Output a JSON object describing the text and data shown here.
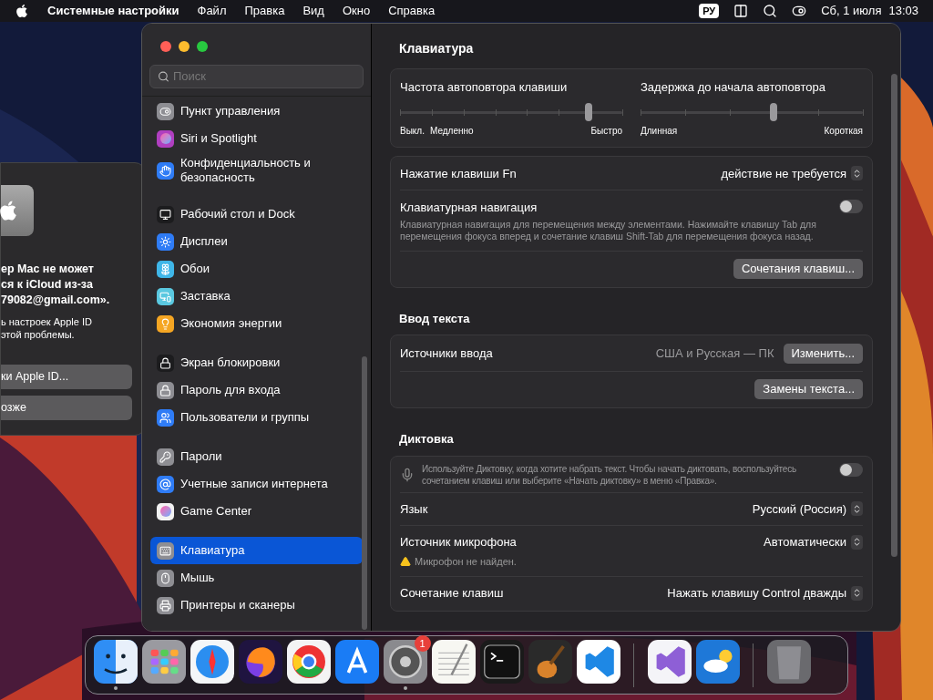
{
  "menu_bar": {
    "app": "Системные настройки",
    "menus": [
      "Файл",
      "Правка",
      "Вид",
      "Окно",
      "Справка"
    ],
    "input_source": "РУ",
    "date": "Сб, 1 июля",
    "time": "13:03"
  },
  "dialog": {
    "title_lines": [
      "ер Mac не может",
      "ся к iCloud из-за",
      "79082@gmail.com»."
    ],
    "body_lines": [
      "ь настроек Apple ID",
      "этой проблемы."
    ],
    "buttons": [
      "ки Apple ID...",
      "озже"
    ]
  },
  "sidebar": {
    "search": {
      "placeholder": "Поиск"
    },
    "groups": [
      [
        {
          "label": "Пункт управления",
          "color": "#8e8e93",
          "selected": false
        },
        {
          "label": "Siri и Spotlight",
          "color": "#b03fc0",
          "selected": false
        },
        {
          "label": "Конфиденциальность и безопасность",
          "color": "#2f7cf6",
          "selected": false
        }
      ],
      [
        {
          "label": "Рабочий стол и Dock",
          "color": "#1c1c1e",
          "selected": false
        },
        {
          "label": "Дисплеи",
          "color": "#2f7cf6",
          "selected": false
        },
        {
          "label": "Обои",
          "color": "#3fb6e8",
          "selected": false
        },
        {
          "label": "Заставка",
          "color": "#5ac8e0",
          "selected": false
        },
        {
          "label": "Экономия энергии",
          "color": "#f5a623",
          "selected": false
        }
      ],
      [
        {
          "label": "Экран блокировки",
          "color": "#1c1c1e",
          "selected": false
        },
        {
          "label": "Пароль для входа",
          "color": "#8e8e93",
          "selected": false
        },
        {
          "label": "Пользователи и группы",
          "color": "#2f7cf6",
          "selected": false
        }
      ],
      [
        {
          "label": "Пароли",
          "color": "#8e8e93",
          "selected": false
        },
        {
          "label": "Учетные записи интернета",
          "color": "#2f7cf6",
          "selected": false
        },
        {
          "label": "Game Center",
          "color": "#f2f2f2",
          "selected": false
        }
      ],
      [
        {
          "label": "Клавиатура",
          "color": "#8e8e93",
          "selected": true
        },
        {
          "label": "Мышь",
          "color": "#8e8e93",
          "selected": false
        },
        {
          "label": "Принтеры и сканеры",
          "color": "#8e8e93",
          "selected": false
        }
      ]
    ]
  },
  "content": {
    "title": "Клавиатура",
    "sliders": [
      {
        "label": "Частота автоповтора клавиши",
        "level": 0.85,
        "left_labels": [
          "Выкл.",
          "Медленно"
        ],
        "right_label": "Быстро"
      },
      {
        "label": "Задержка до начала автоповтора",
        "level": 0.6,
        "left_labels": [
          "Длинная"
        ],
        "right_label": "Короткая"
      }
    ],
    "sections": [
      {
        "rows": [
          {
            "kind": "select",
            "label": "Нажатие клавиши Fn",
            "value": "действие не требуется"
          },
          {
            "kind": "toggle",
            "label": "Клавиатурная навигация",
            "description": "Клавиатурная навигация для перемещения между элементами. Нажимайте клавишу Tab для перемещения фокуса вперед и сочетание клавиш Shift-Tab для перемещения фокуса назад.",
            "on": false
          },
          {
            "kind": "button",
            "button": "Сочетания клавиш..."
          }
        ]
      },
      {
        "heading": "Ввод текста",
        "rows": [
          {
            "kind": "value_button",
            "label": "Источники ввода",
            "value": "США и Русская — ПК",
            "button": "Изменить..."
          },
          {
            "kind": "button",
            "button": "Замены текста..."
          }
        ]
      },
      {
        "heading": "Диктовка",
        "rows": [
          {
            "kind": "mic_toggle",
            "description": "Используйте Диктовку, когда хотите набрать текст. Чтобы начать диктовать, воспользуйтесь сочетанием клавиш или выберите «Начать диктовку» в меню «Правка».",
            "on": false
          },
          {
            "kind": "select",
            "label": "Язык",
            "value": "Русский (Россия)"
          },
          {
            "kind": "select",
            "label": "Источник микрофона",
            "value": "Автоматически",
            "warning": "Микрофон не найден."
          },
          {
            "kind": "select",
            "label": "Сочетание клавиш",
            "value": "Нажать клавишу Control дважды"
          }
        ]
      }
    ]
  },
  "dock": {
    "groups": [
      [
        {
          "color": "#2f8ef5",
          "running": true
        },
        {
          "color": "#9a9aa0",
          "running": false
        },
        {
          "color": "#f4f6f8",
          "running": false
        },
        {
          "color": "#1f1440",
          "running": false
        },
        {
          "color": "#f4f4f4",
          "running": false
        },
        {
          "color": "#1a7cf5",
          "running": false
        },
        {
          "color": "#8a8a8e",
          "running": true,
          "badge": "1"
        },
        {
          "color": "#f7f7f2",
          "running": false
        },
        {
          "color": "#1a1a1a",
          "running": false
        },
        {
          "color": "#2a2a2a",
          "running": false
        },
        {
          "color": "#ffffff",
          "running": false
        }
      ],
      [
        {
          "color": "#f4f4f8",
          "running": false
        },
        {
          "color": "#1e78d8",
          "running": false
        }
      ],
      [
        {
          "color": "#6a6a6e",
          "running": false
        }
      ]
    ]
  }
}
